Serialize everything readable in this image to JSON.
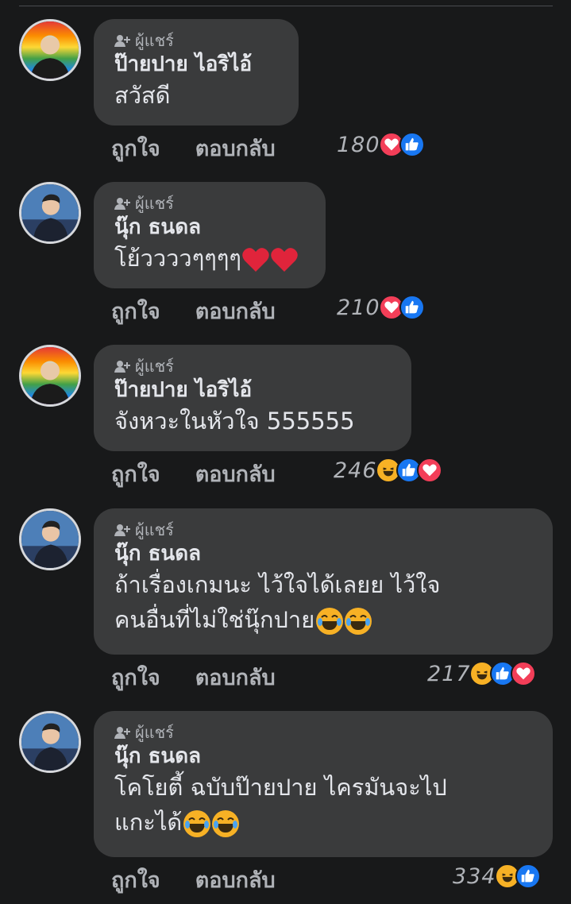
{
  "comments": [
    {
      "badge": "ผู้แชร์",
      "author": "ป๊ายปาย ไอริไอ้",
      "lines": [
        "สวัสดี"
      ],
      "text_emoji": [],
      "like": "ถูกใจ",
      "reply": "ตอบกลับ",
      "reaction_count": "180",
      "reaction_icons": [
        "heart-icon",
        "like-icon"
      ],
      "avatar": "rainbow"
    },
    {
      "badge": "ผู้แชร์",
      "author": "นุ๊ก ธนดล",
      "lines": [
        "โย้ววววๆๆๆๆ"
      ],
      "text_emoji": [
        "red-heart-emoji",
        "red-heart-emoji"
      ],
      "like": "ถูกใจ",
      "reply": "ตอบกลับ",
      "reaction_count": "210",
      "reaction_icons": [
        "heart-icon",
        "like-icon"
      ],
      "avatar": "blue"
    },
    {
      "badge": "ผู้แชร์",
      "author": "ป๊ายปาย ไอริไอ้",
      "lines": [
        "จังหวะในหัวใจ 555555"
      ],
      "text_emoji": [],
      "like": "ถูกใจ",
      "reply": "ตอบกลับ",
      "reaction_count": "246",
      "reaction_icons": [
        "haha-icon",
        "like-icon",
        "heart-icon"
      ],
      "avatar": "rainbow"
    },
    {
      "badge": "ผู้แชร์",
      "author": "นุ๊ก ธนดล",
      "lines": [
        "ถ้าเรื่องเกมนะ ไว้ใจได้เลยย ไว้ใจ",
        "คนอื่นที่ไม่ใช่นุ๊กปาย"
      ],
      "text_emoji": [
        "tears-of-joy-emoji",
        "tears-of-joy-emoji"
      ],
      "like": "ถูกใจ",
      "reply": "ตอบกลับ",
      "reaction_count": "217",
      "reaction_icons": [
        "haha-icon",
        "like-icon",
        "heart-icon"
      ],
      "avatar": "blue"
    },
    {
      "badge": "ผู้แชร์",
      "author": "นุ๊ก ธนดล",
      "lines": [
        "โคโยตี้ ฉบับป๊ายปาย ไครมันจะไป",
        "แกะได้"
      ],
      "text_emoji": [
        "tears-of-joy-emoji",
        "tears-of-joy-emoji"
      ],
      "like": "ถูกใจ",
      "reply": "ตอบกลับ",
      "reaction_count": "334",
      "reaction_icons": [
        "haha-icon",
        "like-icon"
      ],
      "avatar": "blue"
    }
  ],
  "colors": {
    "background": "#18191a",
    "bubble": "#3a3b3c",
    "text": "#e4e6eb",
    "secondary": "#b0b3b8",
    "heart": "#f33e58",
    "like": "#1877f2",
    "haha": "#f7b125"
  }
}
